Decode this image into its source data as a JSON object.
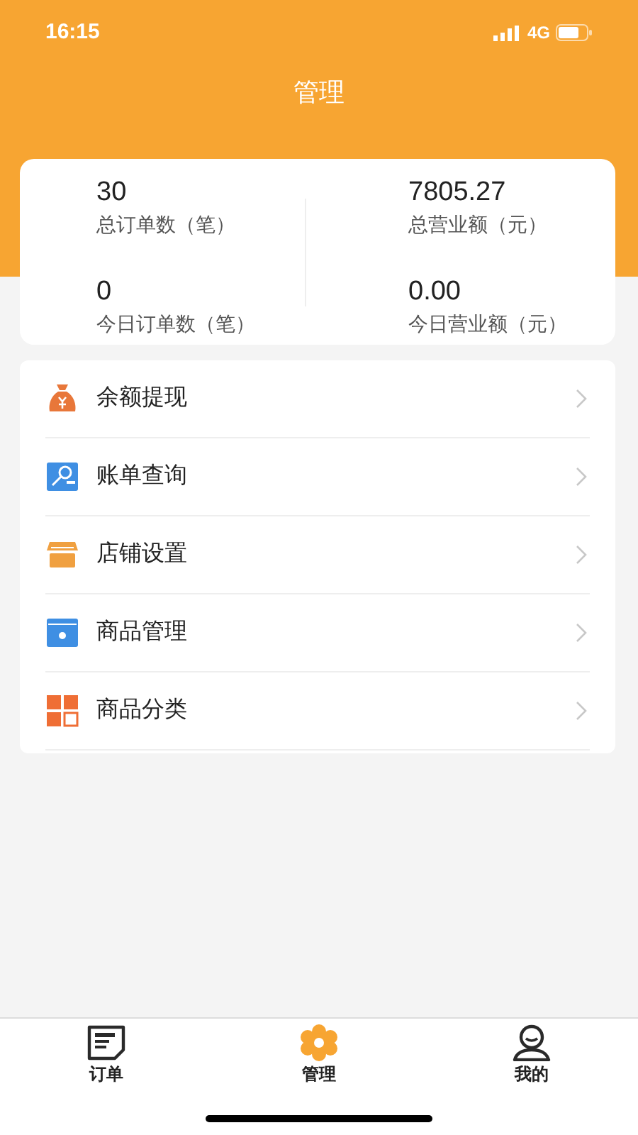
{
  "status_bar": {
    "time": "16:15",
    "network": "4G"
  },
  "header": {
    "title": "管理"
  },
  "stats": [
    {
      "value": "30",
      "label": "总订单数（笔）"
    },
    {
      "value": "7805.27",
      "label": "总营业额（元）"
    },
    {
      "value": "0",
      "label": "今日订单数（笔）"
    },
    {
      "value": "0.00",
      "label": "今日营业额（元）"
    }
  ],
  "menu": [
    {
      "label": "余额提现"
    },
    {
      "label": "账单查询"
    },
    {
      "label": "店铺设置"
    },
    {
      "label": "商品管理"
    },
    {
      "label": "商品分类"
    }
  ],
  "tab_bar": [
    {
      "label": "订单",
      "selected": false
    },
    {
      "label": "管理",
      "selected": true
    },
    {
      "label": "我的",
      "selected": false
    }
  ]
}
